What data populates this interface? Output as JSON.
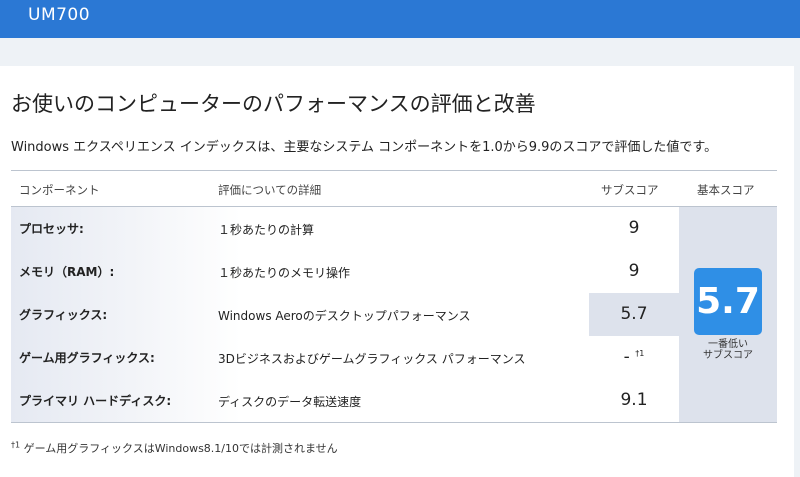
{
  "header": {
    "title": "UM700"
  },
  "page": {
    "heading": "お使いのコンピューターのパフォーマンスの評価と改善",
    "description": "Windows エクスペリエンス インデックスは、主要なシステム コンポーネントを1.0から9.9のスコアで評価した値です。"
  },
  "table": {
    "headers": {
      "component": "コンポーネント",
      "detail": "評価についての詳細",
      "subscore": "サブスコア",
      "base_score": "基本スコア"
    },
    "rows": [
      {
        "component": "プロセッサ:",
        "detail": "１秒あたりの計算",
        "subscore": "9",
        "mark": ""
      },
      {
        "component": "メモリ（RAM）:",
        "detail": "１秒あたりのメモリ操作",
        "subscore": "9",
        "mark": ""
      },
      {
        "component": "グラフィックス:",
        "detail": "Windows Aeroのデスクトップパフォーマンス",
        "subscore": "5.7",
        "mark": ""
      },
      {
        "component": "ゲーム用グラフィックス:",
        "detail": "3Dビジネスおよびゲームグラフィックス パフォーマンス",
        "subscore": "-",
        "mark": "†1"
      },
      {
        "component": "プライマリ ハードディスク:",
        "detail": "ディスクのデータ転送速度",
        "subscore": "9.1",
        "mark": ""
      }
    ],
    "base_score": "5.7",
    "base_note_line1": "一番低い",
    "base_note_line2": "サブスコア",
    "lowest_highlight_color": "#dde2ec",
    "base_box_color": "#2f8fe6"
  },
  "footnote": {
    "mark": "†1",
    "text": " ゲーム用グラフィックスはWindows8.1/10では計測されません"
  }
}
